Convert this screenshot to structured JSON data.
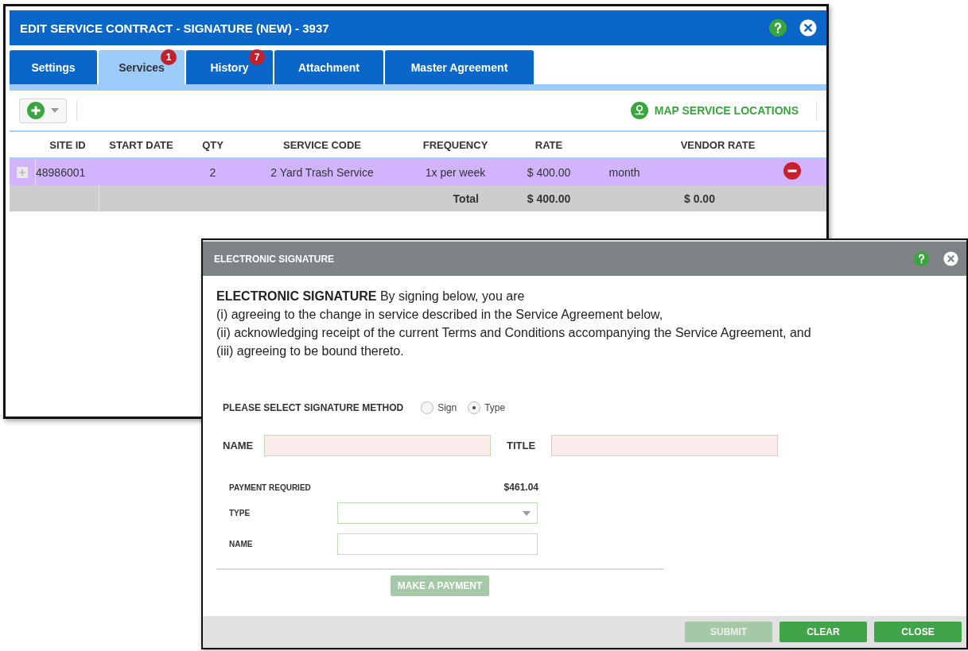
{
  "main_window": {
    "title": "EDIT SERVICE CONTRACT - SIGNATURE (NEW) - 3937",
    "tabs": [
      {
        "label": "Settings",
        "selected": false
      },
      {
        "label": "Services",
        "selected": true,
        "badge": "1"
      },
      {
        "label": "History",
        "selected": false,
        "badge": "7"
      },
      {
        "label": "Attachment",
        "selected": false
      },
      {
        "label": "Master Agreement",
        "selected": false
      }
    ],
    "toolbar": {
      "map_link": "MAP SERVICE LOCATIONS"
    },
    "table": {
      "columns": [
        "SITE ID",
        "START DATE",
        "QTY",
        "SERVICE CODE",
        "FREQUENCY",
        "RATE",
        "VENDOR RATE"
      ],
      "rows": [
        {
          "site_id": "48986001",
          "qty": "2",
          "service_code": "2 Yard Trash Service",
          "frequency": "1x per week",
          "rate": "$ 400.00",
          "period": "month",
          "selected": true
        }
      ],
      "total": {
        "label": "Total",
        "rate": "$ 400.00",
        "vendor_rate": "$ 0.00"
      }
    }
  },
  "dialog": {
    "title": "ELECTRONIC SIGNATURE",
    "intro": [
      "**ELECTRONIC SIGNATURE**  By signing below, you are",
      "(i) agreeing to the change in service described in the Service Agreement below,",
      "(ii) acknowledging receipt of the current Terms and Conditions accompanying the Service Agreement, and",
      "(iii) agreeing to be bound thereto."
    ],
    "signature": {
      "label": "PLEASE SELECT SIGNATURE METHOD",
      "options": [
        {
          "label": "Sign",
          "selected": false
        },
        {
          "label": "Type",
          "selected": true
        }
      ]
    },
    "name_label": "NAME",
    "title_label": "TITLE",
    "payment": {
      "label": "PAYMENT REQURIED",
      "amount": "$461.04",
      "type_label": "TYPE",
      "name_label": "NAME",
      "button": {
        "label": "MAKE A PAYMENT",
        "disabled": true
      }
    },
    "buttons": [
      {
        "label": "SUBMIT",
        "disabled": true
      },
      {
        "label": "CLEAR",
        "disabled": false
      },
      {
        "label": "CLOSE",
        "disabled": false
      }
    ]
  }
}
